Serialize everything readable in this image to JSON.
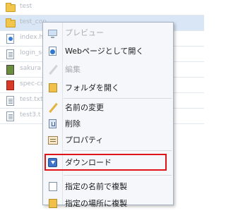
{
  "file_list": {
    "rows": [
      {
        "name": "test",
        "icon": "folder-icon",
        "selected": false
      },
      {
        "name": "test_cop",
        "icon": "folder-icon",
        "selected": true
      },
      {
        "name": "index.htm",
        "icon": "html-file-icon",
        "selected": false
      },
      {
        "name": "login_se",
        "icon": "text-file-icon",
        "selected": false
      },
      {
        "name": "sakura",
        "icon": "image-file-icon",
        "selected": false
      },
      {
        "name": "spec-co",
        "icon": "pdf-file-icon",
        "selected": false
      },
      {
        "name": "test.txt",
        "icon": "text-file-icon",
        "selected": false
      },
      {
        "name": "test3.t",
        "icon": "text-file-icon",
        "selected": false
      }
    ]
  },
  "context_menu": {
    "items": [
      {
        "label": "プレビュー",
        "icon": "preview-monitor-icon",
        "enabled": false
      },
      {
        "label": "Webページとして開く",
        "icon": "web-page-icon",
        "enabled": true
      },
      {
        "label": "編集",
        "icon": "edit-pencil-icon",
        "enabled": false
      },
      {
        "label": "フォルダを開く",
        "icon": "folder-open-icon",
        "enabled": true
      },
      {
        "label": "名前の変更",
        "icon": "rename-pencil-icon",
        "enabled": true
      },
      {
        "label": "削除",
        "icon": "delete-trash-icon",
        "enabled": true
      },
      {
        "label": "プロパティ",
        "icon": "properties-icon",
        "enabled": true
      },
      {
        "label": "ダウンロード",
        "icon": "download-icon",
        "enabled": true,
        "highlighted": true
      },
      {
        "label": "指定の名前で複製",
        "icon": "copy-as-icon",
        "enabled": true
      },
      {
        "label": "指定の場所に複製",
        "icon": "copy-to-icon",
        "enabled": true
      }
    ],
    "highlight_color": "#e0131a"
  }
}
